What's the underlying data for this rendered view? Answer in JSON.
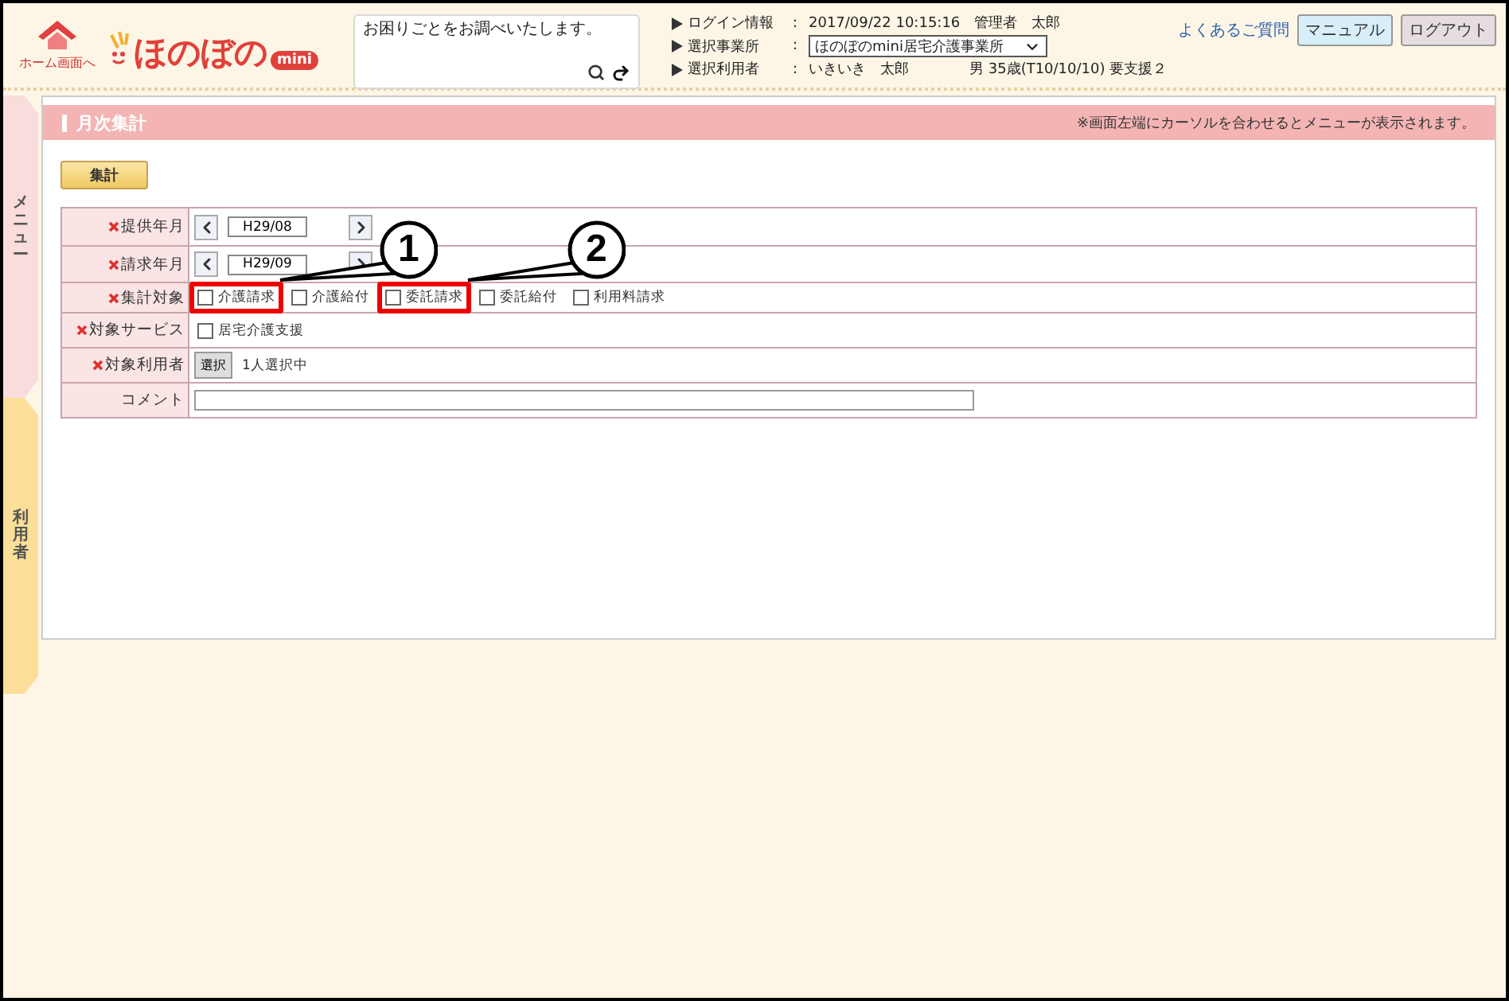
{
  "header": {
    "home_link": "ホーム画面へ",
    "logo": "ほのぼの",
    "logo_badge": "mini",
    "search": {
      "placeholder": "お困りごとをお調べいたします。"
    },
    "info": [
      {
        "label": "ログイン情報",
        "separator": ":",
        "kind": "text",
        "value": "2017/09/22 10:15:16　管理者　太郎"
      },
      {
        "label": "選択事業所",
        "separator": ":",
        "kind": "select",
        "value": "ほのぼのmini居宅介護事業所"
      },
      {
        "label": "選択利用者",
        "separator": ":",
        "kind": "text",
        "value": "いきいき　太郎",
        "extra": "男 35歳(T10/10/10) 要支援２"
      }
    ],
    "links": [
      {
        "label": "よくあるご質問",
        "kind": "link"
      },
      {
        "label": "マニュアル",
        "kind": "manual"
      },
      {
        "label": "ログアウト",
        "kind": "logout"
      }
    ]
  },
  "side_tabs": [
    {
      "label": "メニュー",
      "kind": "menu"
    },
    {
      "label": "利用者",
      "kind": "user"
    }
  ],
  "panel": {
    "title": "月次集計",
    "note": "※画面左端にカーソルを合わせるとメニューが表示されます。",
    "action": "集計",
    "rows": [
      {
        "label": "提供年月",
        "required": true,
        "kind": "month",
        "value": "H29/08"
      },
      {
        "label": "請求年月",
        "required": true,
        "kind": "month",
        "value": "H29/09"
      },
      {
        "label": "集計対象",
        "required": true,
        "kind": "checks",
        "options": [
          {
            "label": "介護請求",
            "checked": false,
            "callout": "1"
          },
          {
            "label": "介護給付",
            "checked": false
          },
          {
            "label": "委託請求",
            "checked": false,
            "callout": "2"
          },
          {
            "label": "委託給付",
            "checked": false
          },
          {
            "label": "利用料請求",
            "checked": false
          }
        ]
      },
      {
        "label": "対象サービス",
        "required": true,
        "kind": "checks",
        "options": [
          {
            "label": "居宅介護支援",
            "checked": false
          }
        ]
      },
      {
        "label": "対象利用者",
        "required": true,
        "kind": "picker",
        "button": "選択",
        "value": "1人選択中"
      },
      {
        "label": "コメント",
        "required": false,
        "kind": "text"
      }
    ]
  }
}
